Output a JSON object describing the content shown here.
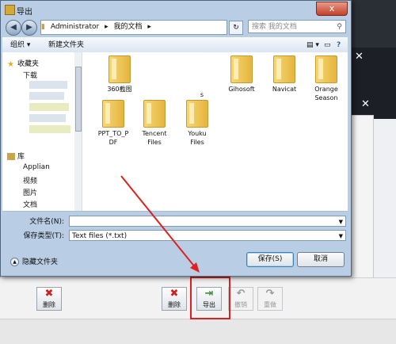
{
  "dialog": {
    "title": "导出",
    "close": "x",
    "address_path": [
      "Administrator",
      "▸",
      "我的文档",
      "▸"
    ],
    "refresh": "↻",
    "search_placeholder": "搜索 我的文档",
    "organize_label": "组织 ▾",
    "new_folder_label": "新建文件夹",
    "nav": {
      "favorites": "收藏夹",
      "downloads": "下载",
      "library": "库",
      "libs": [
        "Applian",
        "视频",
        "图片",
        "文档"
      ]
    },
    "files": [
      {
        "name": "360截图"
      },
      {
        "name": "Gihosoft"
      },
      {
        "name": "Navicat"
      },
      {
        "name": "OrangeSeason"
      },
      {
        "name": "PPT_TO_PDF"
      },
      {
        "name": "Tencent Files"
      },
      {
        "name": "Youku Files"
      },
      {
        "name": "s"
      }
    ],
    "filename_label": "文件名(N):",
    "filename_value": "",
    "filetype_label": "保存类型(T):",
    "filetype_value": "Text files (*.txt)",
    "hide_folders": "隐藏文件夹",
    "save_button": "保存(S)",
    "cancel_button": "取消"
  },
  "background_app": {
    "delete_label_left": "删除",
    "delete_label_right": "删除",
    "export_label": "导出",
    "undo_label": "撤销",
    "redo_label": "重做"
  },
  "colors": {
    "highlight_box": "#e02020",
    "annotation_arrow": "#e02020"
  }
}
